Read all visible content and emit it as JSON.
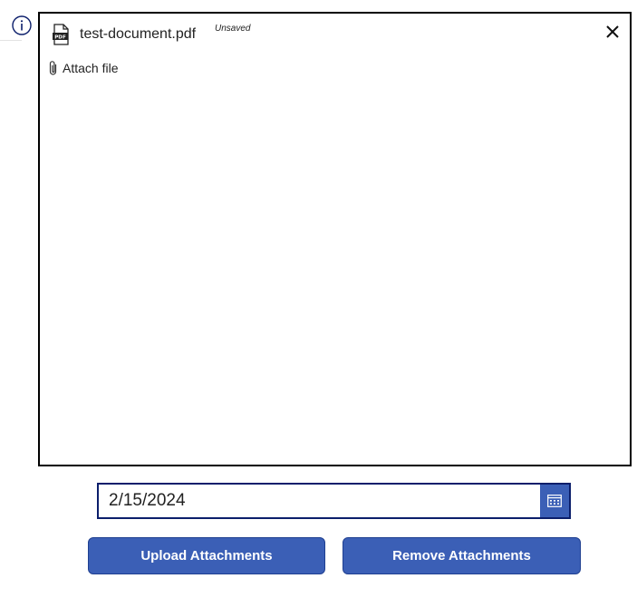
{
  "info": {
    "icon": "info-icon"
  },
  "attachments": {
    "file": {
      "name": "test-document.pdf",
      "status": "Unsaved",
      "icon": "pdf-file-icon"
    },
    "close_icon": "close-icon",
    "attach_label": "Attach file",
    "attach_icon": "paperclip-icon"
  },
  "date_field": {
    "value": "2/15/2024",
    "icon": "calendar-icon"
  },
  "buttons": {
    "upload_label": "Upload Attachments",
    "remove_label": "Remove Attachments"
  },
  "colors": {
    "accent": "#3b5fb6",
    "field_border": "#0b1e6b",
    "info_icon": "#0b1e6b"
  }
}
